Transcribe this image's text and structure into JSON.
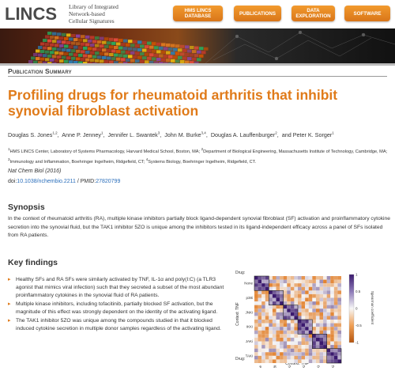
{
  "header": {
    "logo_text": "LINCS",
    "library_lines": [
      "Library of Integrated",
      "Network-based",
      "Cellular Signatures"
    ],
    "nav": [
      {
        "line1": "HMS LINCS",
        "line2": "DATABASE"
      },
      {
        "line1": "PUBLICATIONS",
        "line2": ""
      },
      {
        "line1": "DATA",
        "line2": "EXPLORATION"
      },
      {
        "line1": "SOFTWARE",
        "line2": ""
      }
    ]
  },
  "kicker": "Publication Summary",
  "title": "Profiling drugs for rheumatoid arthritis that inhibit synovial fibroblast activation",
  "authors": [
    {
      "name": "Douglas S. Jones",
      "sup": "1,2"
    },
    {
      "name": "Anne P. Jenney",
      "sup": "1"
    },
    {
      "name": "Jennifer L. Swantek",
      "sup": "3"
    },
    {
      "name": "John M. Burke",
      "sup": "3,4"
    },
    {
      "name": "Douglas A. Lauffenburger",
      "sup": "2"
    },
    {
      "name": "and Peter K. Sorger",
      "sup": "1"
    }
  ],
  "affiliations": [
    {
      "sup": "1",
      "text": "HMS LINCS Center, Laboratory of Systems Pharmacology, Harvard Medical School, Boston, MA; "
    },
    {
      "sup": "2",
      "text": "Department of Biological Engineering, Massachusetts Institute of Technology, Cambridge, MA; "
    },
    {
      "sup": "3",
      "text": "Immunology and Inflammation, Boehringer Ingelheim, Ridgefield, CT; "
    },
    {
      "sup": "4",
      "text": "Systems Biology, Boehringer Ingelheim, Ridgefield, CT."
    }
  ],
  "journal": "Nat Chem Biol (2016)",
  "doi_prefix": "doi:",
  "doi": "10.1038/nchembio.2211",
  "pmid_prefix": " / PMID:",
  "pmid": "27820799",
  "synopsis_heading": "Synopsis",
  "synopsis_text": "In the context of rheumatoid arthritis (RA), multiple kinase inhibitors partially block ligand-dependent synovial fibroblast (SF) activation and proinflammatory cytokine secretion into the synovial fluid, but the TAK1 inhibitor 5ZO is unique among the inhibitors tested in its ligand-independent efficacy across a panel of SFs isolated from RA patients.",
  "key_findings_heading": "Key findings",
  "key_findings": [
    "Healthy SFs and RA SFs were similarly activated by TNF, IL-1α and poly(I:C) (a TLR3 agonist that mimics viral infection) such that they secreted a subset of the most abundant proinflammatory cytokines in the synovial fluid of RA patients.",
    "Multiple kinase inhibitors, including tofacitinib, partially blocked SF activation, but the magnitude of this effect was strongly dependent on the identity of the activating ligand.",
    "The TAK1 inhibitor 5ZO was unique among the compounds studied in that it blocked induced cytokine secretion in multiple donor samples regardless of the activating ligand."
  ],
  "figure": {
    "drug_label": "Drug:",
    "context_label": "Context: TNF",
    "colorbar_label": "Spearman coefficient",
    "row_labels": [
      "None",
      "p38i",
      "JNKi",
      "IKKi",
      "JAKi",
      "TAKi"
    ],
    "col_labels": [
      "None",
      "p38i",
      "JNKi",
      "IKKi",
      "JAKi",
      "TAKi"
    ],
    "colorbar_ticks": [
      "1",
      "0.5",
      "0",
      "-0.5",
      "-1"
    ],
    "colors": {
      "high": "#3b1a6e",
      "mid": "#f7f7f7",
      "low": "#e0761a"
    }
  },
  "colors": {
    "accent": "#e07b1a",
    "link": "#2a6ebb"
  }
}
